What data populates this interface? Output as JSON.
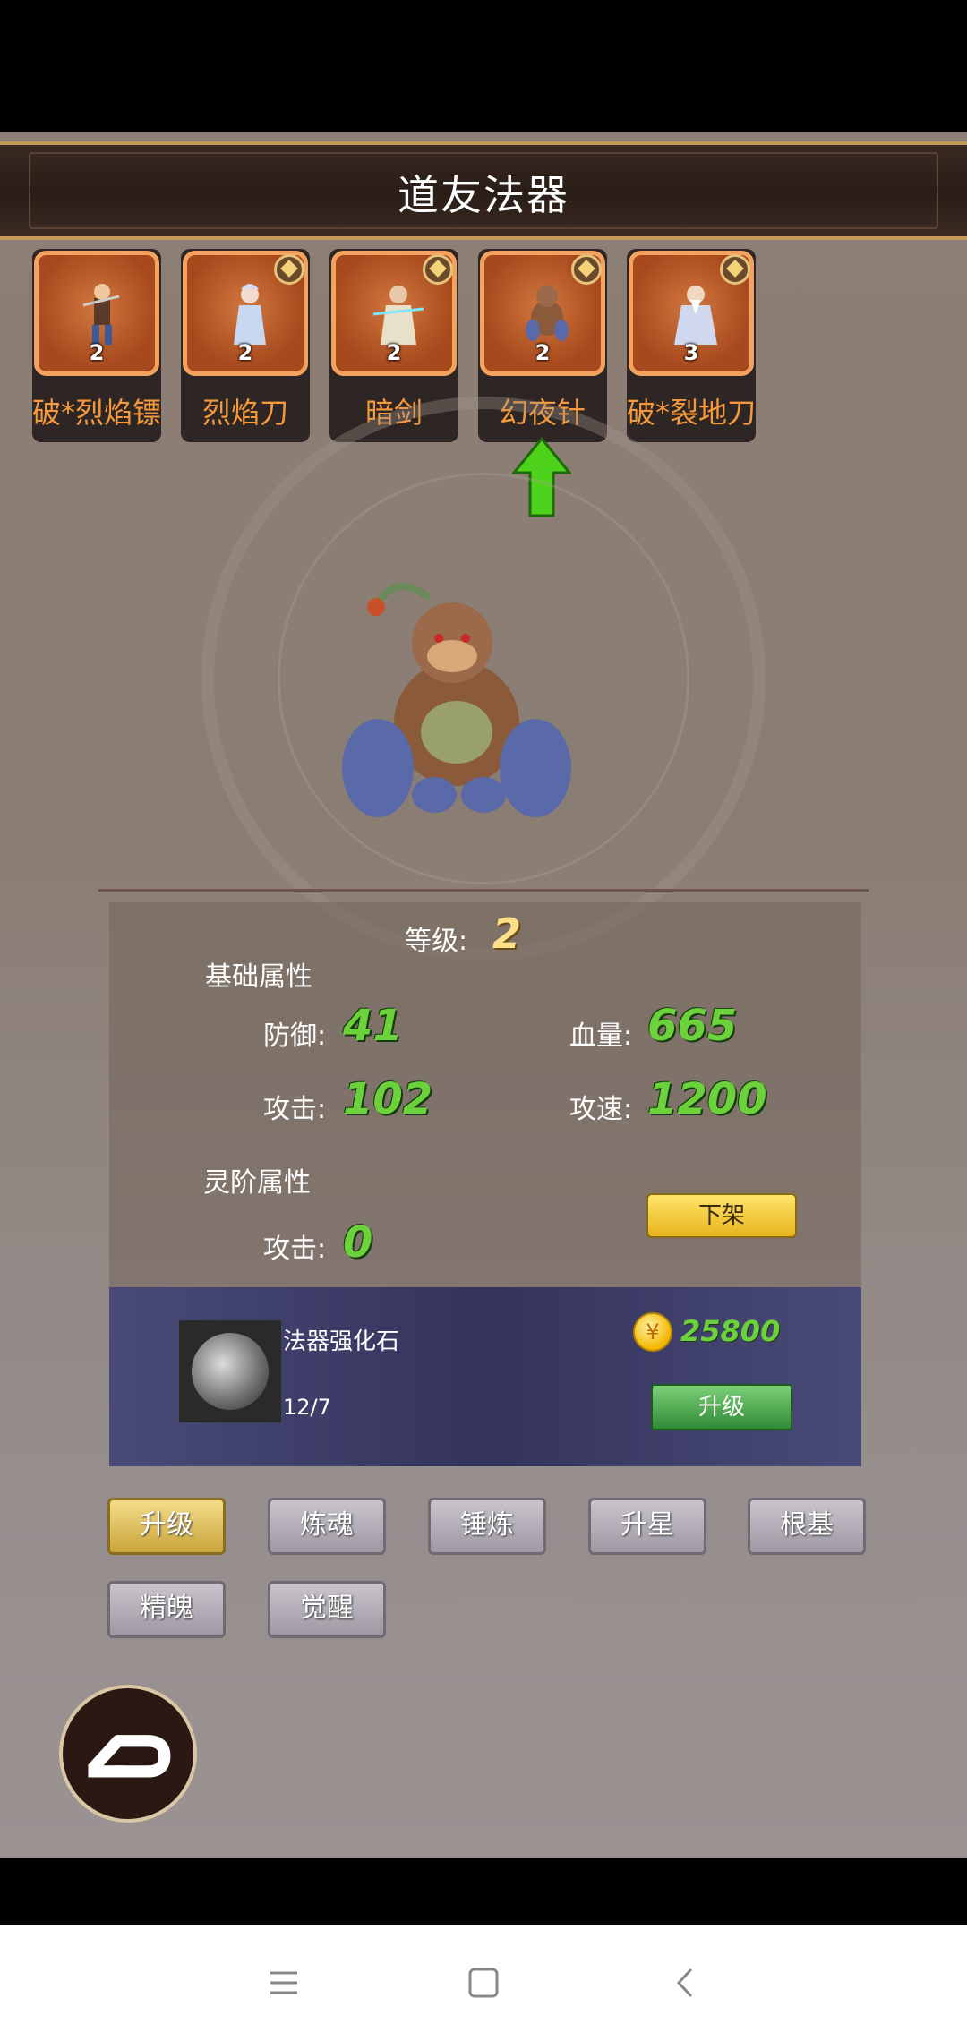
{
  "header": {
    "title": "道友法器"
  },
  "roster": [
    {
      "name": "破*烈焰镖",
      "level": "2",
      "starred": false
    },
    {
      "name": "烈焰刀",
      "level": "2",
      "starred": true
    },
    {
      "name": "暗剑",
      "level": "2",
      "starred": true
    },
    {
      "name": "幻夜针",
      "level": "2",
      "starred": true
    },
    {
      "name": "破*裂地刀",
      "level": "3",
      "starred": true
    }
  ],
  "selected_index": 3,
  "stats": {
    "level_label": "等级:",
    "level_value": "2",
    "base_title": "基础属性",
    "defense_label": "防御:",
    "defense_value": "41",
    "hp_label": "血量:",
    "hp_value": "665",
    "attack_label": "攻击:",
    "attack_value": "102",
    "speed_label": "攻速:",
    "speed_value": "1200",
    "spirit_title": "灵阶属性",
    "spirit_attack_label": "攻击:",
    "spirit_attack_value": "0",
    "unequip_label": "下架"
  },
  "material": {
    "name": "法器强化石",
    "count": "12/7",
    "coin_symbol": "¥",
    "cost": "25800",
    "upgrade_label": "升级"
  },
  "tabs": [
    "升级",
    "炼魂",
    "锤炼",
    "升星",
    "根基",
    "精魄",
    "觉醒"
  ],
  "active_tab": 0,
  "colors": {
    "stat_green": "#6cd23b",
    "roster_name": "#f59a3c",
    "level_gold": "#ffdf87"
  }
}
